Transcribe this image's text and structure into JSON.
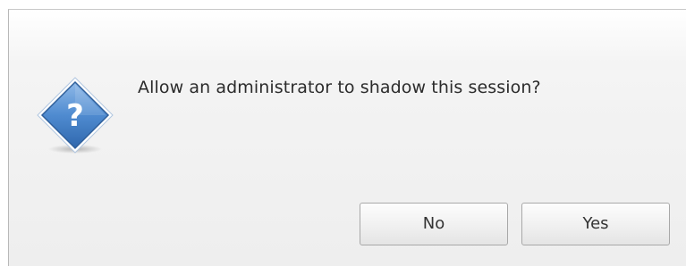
{
  "dialog": {
    "icon": "question-icon",
    "icon_glyph": "?",
    "message": "Allow an administrator to shadow this session?",
    "buttons": {
      "no_label": "No",
      "yes_label": "Yes"
    }
  },
  "colors": {
    "icon_fill": "#4a86c8",
    "icon_border": "#2f5f9a",
    "text": "#2b2b2b"
  }
}
